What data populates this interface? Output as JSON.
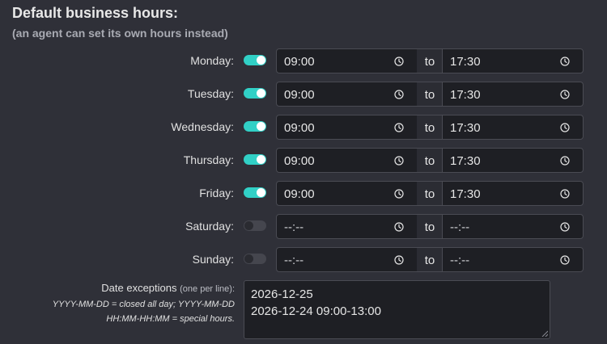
{
  "header": {
    "title": "Default business hours:",
    "subtitle": "(an agent can set its own hours instead)"
  },
  "separator": "to",
  "days": [
    {
      "label": "Monday:",
      "enabled": true,
      "from": "09:00",
      "to": "17:30"
    },
    {
      "label": "Tuesday:",
      "enabled": true,
      "from": "09:00",
      "to": "17:30"
    },
    {
      "label": "Wednesday:",
      "enabled": true,
      "from": "09:00",
      "to": "17:30"
    },
    {
      "label": "Thursday:",
      "enabled": true,
      "from": "09:00",
      "to": "17:30"
    },
    {
      "label": "Friday:",
      "enabled": true,
      "from": "09:00",
      "to": "17:30"
    },
    {
      "label": "Saturday:",
      "enabled": false,
      "from": "--:--",
      "to": "--:--"
    },
    {
      "label": "Sunday:",
      "enabled": false,
      "from": "--:--",
      "to": "--:--"
    }
  ],
  "exceptions": {
    "label": "Date exceptions",
    "note": "(one per line):",
    "help_line1": "YYYY-MM-DD = closed all day; YYYY-MM-DD",
    "help_line2": "HH:MM-HH:MM = special hours.",
    "lines": [
      "2026-12-25",
      "2026-12-24 09:00-13:00"
    ]
  },
  "colors": {
    "background": "#2f3038",
    "toggle_on": "#31d0c6",
    "toggle_off": "#45464e",
    "field": "#1e1f24"
  }
}
